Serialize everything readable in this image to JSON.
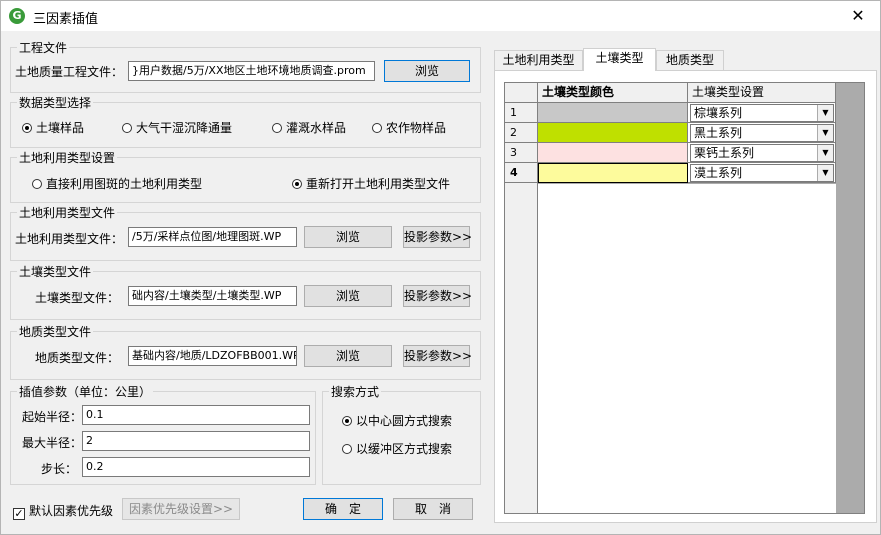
{
  "window": {
    "title": "三因素插值",
    "app_icon_glyph": "G",
    "close_glyph": "✕"
  },
  "project_file": {
    "legend": "工程文件",
    "label": "土地质量工程文件：",
    "value": "}用户数据/5万/XX地区土地环境地质调查.prom",
    "browse": "浏览"
  },
  "data_type": {
    "legend": "数据类型选择",
    "options": [
      "土壤样品",
      "大气干湿沉降通量",
      "灌溉水样品",
      "农作物样品"
    ],
    "selected": 0
  },
  "landuse_setting": {
    "legend": "土地利用类型设置",
    "options": [
      "直接利用图斑的土地利用类型",
      "重新打开土地利用类型文件"
    ],
    "selected": 1
  },
  "landuse_file": {
    "legend": "土地利用类型文件",
    "label": "土地利用类型文件：",
    "value": "/5万/采样点位图/地理图斑.WP",
    "browse": "浏览",
    "proj": "投影参数>>"
  },
  "soil_file": {
    "legend": "土壤类型文件",
    "label": "土壤类型文件：",
    "value": "础内容/土壤类型/土壤类型.WP",
    "browse": "浏览",
    "proj": "投影参数>>"
  },
  "geology_file": {
    "legend": "地质类型文件",
    "label": "地质类型文件：",
    "value": "基础内容/地质/LDZOFBB001.WP",
    "browse": "浏览",
    "proj": "投影参数>>"
  },
  "interp": {
    "legend": "插值参数（单位：公里）",
    "start_radius_label": "起始半径：",
    "start_radius": "0.1",
    "max_radius_label": "最大半径：",
    "max_radius": "2",
    "step_label": "步长：",
    "step": "0.2"
  },
  "search": {
    "legend": "搜索方式",
    "options": [
      "以中心圆方式搜索",
      "以缓冲区方式搜索"
    ],
    "selected": 0
  },
  "bottom": {
    "default_priority_label": "默认因素优先级",
    "default_priority_checked": true,
    "check_glyph": "✓",
    "priority_settings": "因素优先级设置>>",
    "ok": "确　定",
    "cancel": "取　消"
  },
  "tabs": [
    "土地利用类型",
    "土壤类型",
    "地质类型"
  ],
  "active_tab": 1,
  "grid": {
    "col_color": "土壤类型颜色",
    "col_setting": "土壤类型设置",
    "rows": [
      {
        "num": "1",
        "color": "#c8c8c8",
        "setting": "棕壤系列"
      },
      {
        "num": "2",
        "color": "#bfe000",
        "setting": "黑土系列"
      },
      {
        "num": "3",
        "color": "#fde1e1",
        "setting": "栗钙土系列"
      },
      {
        "num": "4",
        "color": "#fdfb9c",
        "setting": "漠土系列"
      }
    ],
    "dropdown_glyph": "▼"
  }
}
